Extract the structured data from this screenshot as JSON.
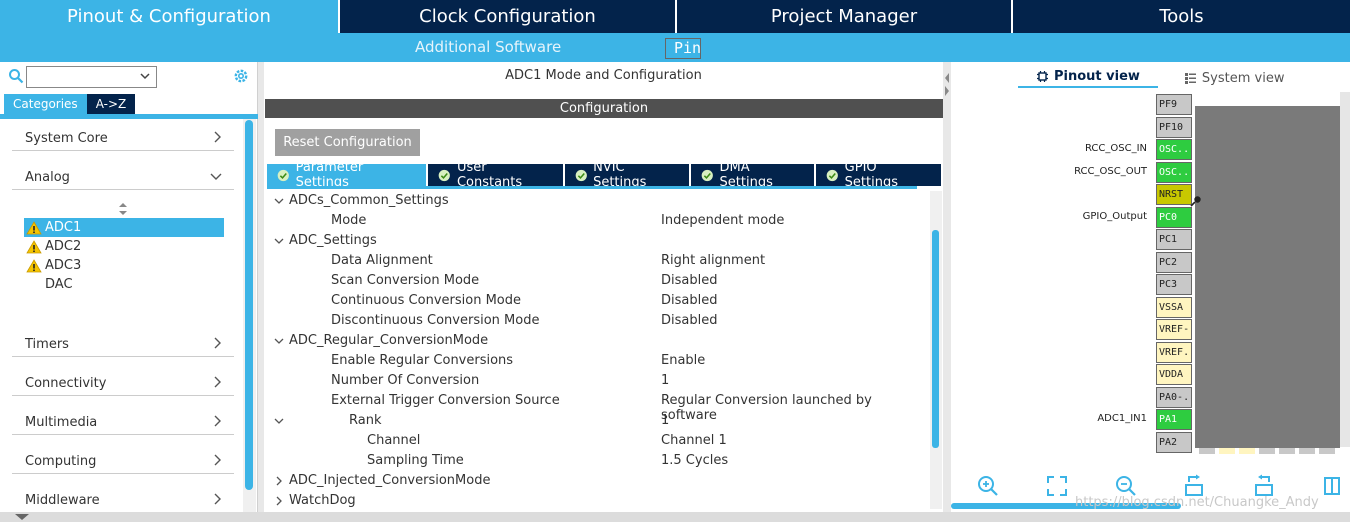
{
  "topnav": {
    "tabs": [
      {
        "label": "Pinout & Configuration",
        "active": true
      },
      {
        "label": "Clock Configuration",
        "active": false
      },
      {
        "label": "Project Manager",
        "active": false
      },
      {
        "label": "Tools",
        "active": false
      }
    ]
  },
  "subnav": {
    "additional_software": "Additional Software",
    "pinout": "Pinout"
  },
  "left": {
    "category_tabs": [
      "Categories",
      "A->Z"
    ],
    "categories": [
      {
        "label": "System Core",
        "expanded": false
      },
      {
        "label": "Analog",
        "expanded": true
      },
      {
        "label": "Timers",
        "expanded": false
      },
      {
        "label": "Connectivity",
        "expanded": false
      },
      {
        "label": "Multimedia",
        "expanded": false
      },
      {
        "label": "Computing",
        "expanded": false
      },
      {
        "label": "Middleware",
        "expanded": false
      }
    ],
    "analog_items": [
      {
        "label": "ADC1",
        "warning": true,
        "selected": true
      },
      {
        "label": "ADC2",
        "warning": true,
        "selected": false
      },
      {
        "label": "ADC3",
        "warning": true,
        "selected": false
      },
      {
        "label": "DAC",
        "warning": false,
        "selected": false
      }
    ]
  },
  "middle": {
    "title": "ADC1 Mode and Configuration",
    "config_header": "Configuration",
    "reset_button": "Reset Configuration",
    "param_tabs": [
      {
        "label": "Parameter Settings",
        "active": true
      },
      {
        "label": "User Constants",
        "active": false
      },
      {
        "label": "NVIC Settings",
        "active": false
      },
      {
        "label": "DMA Settings",
        "active": false
      },
      {
        "label": "GPIO Settings",
        "active": false
      }
    ],
    "tree": [
      {
        "key": "ADCs_Common_Settings",
        "value": "",
        "level": 0,
        "toggle": "open"
      },
      {
        "key": "Mode",
        "value": "Independent mode",
        "level": 1,
        "toggle": ""
      },
      {
        "key": "ADC_Settings",
        "value": "",
        "level": 0,
        "toggle": "open"
      },
      {
        "key": "Data Alignment",
        "value": "Right alignment",
        "level": 1,
        "toggle": ""
      },
      {
        "key": "Scan Conversion Mode",
        "value": "Disabled",
        "level": 1,
        "toggle": ""
      },
      {
        "key": "Continuous Conversion Mode",
        "value": "Disabled",
        "level": 1,
        "toggle": ""
      },
      {
        "key": "Discontinuous Conversion Mode",
        "value": "Disabled",
        "level": 1,
        "toggle": ""
      },
      {
        "key": "ADC_Regular_ConversionMode",
        "value": "",
        "level": 0,
        "toggle": "open"
      },
      {
        "key": "Enable Regular Conversions",
        "value": "Enable",
        "level": 1,
        "toggle": ""
      },
      {
        "key": "Number Of Conversion",
        "value": "1",
        "level": 1,
        "toggle": ""
      },
      {
        "key": "External Trigger Conversion Source",
        "value": "Regular Conversion launched by software",
        "level": 1,
        "toggle": ""
      },
      {
        "key": "Rank",
        "value": "1",
        "level": 2,
        "toggle": "open"
      },
      {
        "key": "Channel",
        "value": "Channel 1",
        "level": 3,
        "toggle": ""
      },
      {
        "key": "Sampling Time",
        "value": "1.5 Cycles",
        "level": 3,
        "toggle": ""
      },
      {
        "key": "ADC_Injected_ConversionMode",
        "value": "",
        "level": 0,
        "toggle": "closed"
      },
      {
        "key": "WatchDog",
        "value": "",
        "level": 0,
        "toggle": "closed"
      }
    ]
  },
  "right": {
    "view_tabs": [
      {
        "label": "Pinout view",
        "active": true
      },
      {
        "label": "System view",
        "active": false
      }
    ],
    "pins": [
      {
        "name": "PF9",
        "color": "gray",
        "signal": ""
      },
      {
        "name": "PF10",
        "color": "gray",
        "signal": ""
      },
      {
        "name": "OSC...",
        "color": "green",
        "signal": "RCC_OSC_IN"
      },
      {
        "name": "OSC...",
        "color": "green",
        "signal": "RCC_OSC_OUT"
      },
      {
        "name": "NRST",
        "color": "yellowg",
        "signal": ""
      },
      {
        "name": "PC0",
        "color": "green",
        "signal": "GPIO_Output"
      },
      {
        "name": "PC1",
        "color": "gray",
        "signal": ""
      },
      {
        "name": "PC2",
        "color": "gray",
        "signal": ""
      },
      {
        "name": "PC3",
        "color": "gray",
        "signal": ""
      },
      {
        "name": "VSSA",
        "color": "cream",
        "signal": ""
      },
      {
        "name": "VREF-",
        "color": "cream",
        "signal": ""
      },
      {
        "name": "VREF...",
        "color": "cream",
        "signal": ""
      },
      {
        "name": "VDDA",
        "color": "cream",
        "signal": ""
      },
      {
        "name": "PA0-...",
        "color": "gray",
        "signal": ""
      },
      {
        "name": "PA1",
        "color": "green",
        "signal": "ADC1_IN1"
      },
      {
        "name": "PA2",
        "color": "gray",
        "signal": ""
      }
    ],
    "watermark": "https://blog.csdn.net/Chuangke_Andy"
  },
  "colors": {
    "navy": "#03234b",
    "accent": "#3cb4e6",
    "pin_green": "#2ecc40",
    "pin_gray": "#c8c8c8",
    "pin_cream": "#fff5c0",
    "pin_nrst": "#c8c800",
    "warning": "#f5c400"
  }
}
